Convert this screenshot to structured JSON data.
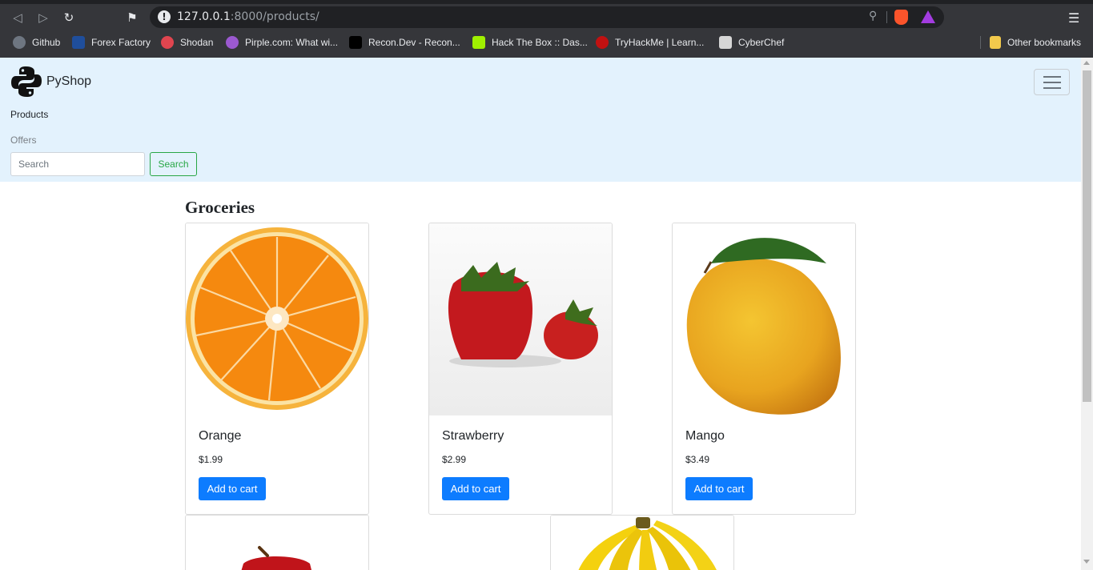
{
  "browser": {
    "url_host": "127.0.0.1",
    "url_rest": ":8000/products/",
    "bookmarks": [
      {
        "label": "Github",
        "icon": "github-icon",
        "color": "#6e7681"
      },
      {
        "label": "Forex Factory",
        "icon": "forexfactory-icon",
        "color": "#1f4e9b"
      },
      {
        "label": "Shodan",
        "icon": "shodan-icon",
        "color": "#e0454f"
      },
      {
        "label": "Pirple.com: What wi...",
        "icon": "pirple-icon",
        "color": "#9b59d0"
      },
      {
        "label": "Recon.Dev - Recon...",
        "icon": "recondev-icon",
        "color": "#000000"
      },
      {
        "label": "Hack The Box :: Das...",
        "icon": "hackthebox-icon",
        "color": "#9fef00"
      },
      {
        "label": "TryHackMe | Learn...",
        "icon": "tryhackme-icon",
        "color": "#c11111"
      },
      {
        "label": "CyberChef",
        "icon": "cyberchef-icon",
        "color": "#d6d6d6"
      }
    ],
    "other_bookmarks": "Other bookmarks"
  },
  "navbar": {
    "brand": "PyShop",
    "links": {
      "products": "Products",
      "offers": "Offers"
    },
    "search": {
      "placeholder": "Search",
      "button": "Search"
    }
  },
  "main": {
    "category": "Groceries",
    "add_to_cart": "Add to cart",
    "products": [
      {
        "name": "Orange",
        "price": "$1.99"
      },
      {
        "name": "Strawberry",
        "price": "$2.99"
      },
      {
        "name": "Mango",
        "price": "$3.49"
      }
    ]
  },
  "colors": {
    "navbar_bg": "#e3f2fd",
    "primary": "#0d7cff",
    "success": "#28a745"
  }
}
